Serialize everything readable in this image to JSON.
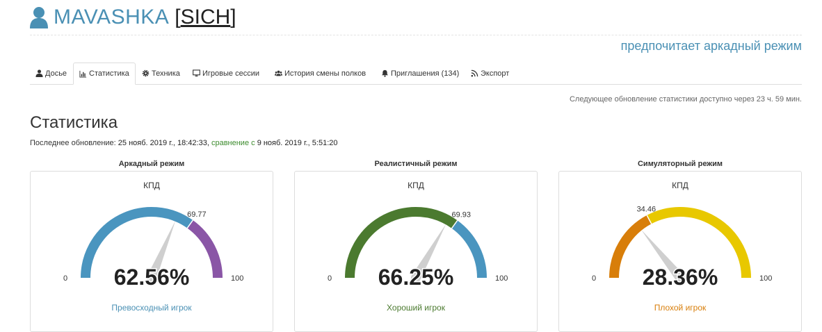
{
  "header": {
    "player_name": "MAVASHKA",
    "clan_open": "[",
    "clan_tag": "SICH",
    "clan_close": "]",
    "preference": "предпочитает аркадный режим"
  },
  "tabs": [
    {
      "label": "Досье",
      "icon": "user-icon"
    },
    {
      "label": "Статистика",
      "icon": "chart-icon",
      "active": true
    },
    {
      "label": "Техника",
      "icon": "gear-icon"
    },
    {
      "label": "Игровые сессии",
      "icon": "monitor-icon"
    },
    {
      "label": "История смены полков",
      "icon": "users-icon"
    },
    {
      "label": "Приглашения (134)",
      "icon": "bell-icon"
    },
    {
      "label": "Экспорт",
      "icon": "rss-icon"
    }
  ],
  "next_update": "Следующее обновление статистики доступно через 23 ч. 59 мин.",
  "section_title": "Статистика",
  "last_update": {
    "label": "Последнее обновление:",
    "date": "25 нояб. 2019 г., 18:42:33,",
    "compare": "сравнение с",
    "compare_date": "9 нояб. 2019 г., 5:51:20"
  },
  "gauges": [
    {
      "title": "Аркадный режим",
      "label": "КПД",
      "value_text": "62.56%",
      "value": 62.56,
      "marker_text": "69.77",
      "marker": 69.77,
      "min_text": "0",
      "max_text": "100",
      "rating": "Превосходный игрок",
      "color_low": "#4a95bf",
      "color_high": "#8a56a6",
      "rating_color": "#4a90b4"
    },
    {
      "title": "Реалистичный режим",
      "label": "КПД",
      "value_text": "66.25%",
      "value": 66.25,
      "marker_text": "69.93",
      "marker": 69.93,
      "min_text": "0",
      "max_text": "100",
      "rating": "Хороший игрок",
      "color_low": "#4b7a2f",
      "color_high": "#4a95bf",
      "rating_color": "#4b7a2f"
    },
    {
      "title": "Симуляторный режим",
      "label": "КПД",
      "value_text": "28.36%",
      "value": 28.36,
      "marker_text": "34.46",
      "marker": 34.46,
      "min_text": "0",
      "max_text": "100",
      "rating": "Плохой игрок",
      "color_low": "#d87e0a",
      "color_high": "#e8c800",
      "rating_color": "#d87e0a"
    }
  ]
}
